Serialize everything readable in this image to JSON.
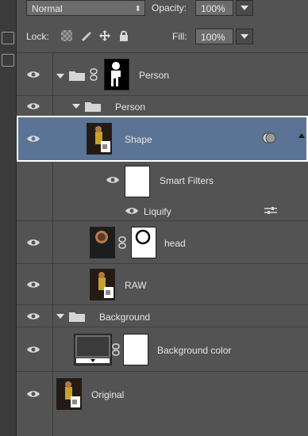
{
  "options": {
    "blend_mode": "Normal",
    "opacity_label": "Opacity:",
    "opacity_value": "100%",
    "lock_label": "Lock:",
    "fill_label": "Fill:",
    "fill_value": "100%"
  },
  "layers": [
    {
      "name": "Person",
      "type": "group-with-mask",
      "expanded": true
    },
    {
      "name": "Person",
      "type": "group",
      "expanded": true
    },
    {
      "name": "Shape",
      "type": "smart-object",
      "selected": true
    },
    {
      "name": "Smart Filters",
      "type": "smart-filters"
    },
    {
      "name": "Liquify",
      "type": "filter"
    },
    {
      "name": "head",
      "type": "layer-with-mask"
    },
    {
      "name": "RAW",
      "type": "smart-object"
    },
    {
      "name": "Background",
      "type": "group",
      "expanded": true
    },
    {
      "name": "Background color",
      "type": "fill-with-mask"
    },
    {
      "name": "Original",
      "type": "smart-object"
    }
  ],
  "colors": {
    "panel_bg": "#535353",
    "selected_bg": "#5b7394",
    "selected_border": "#ffffff",
    "text": "#e6e6e6"
  }
}
